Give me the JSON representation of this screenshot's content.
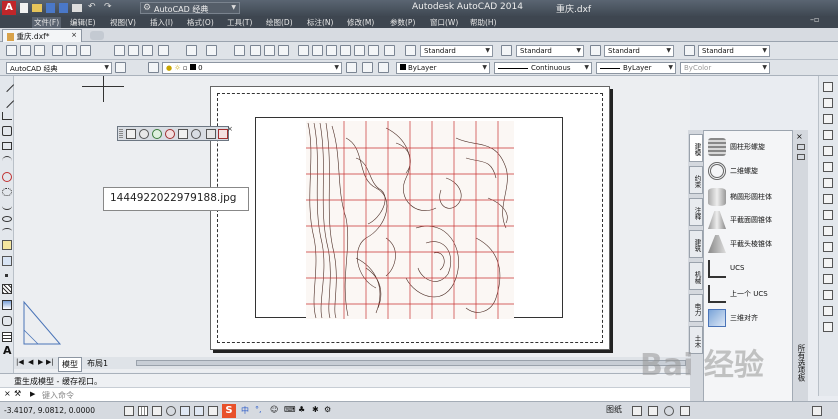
{
  "title_bar": {
    "workspace": "AutoCAD 经典",
    "app_title": "Autodesk AutoCAD 2014",
    "file_title": "重庆.dxf"
  },
  "menu": [
    "文件(F)",
    "编辑(E)",
    "视图(V)",
    "插入(I)",
    "格式(O)",
    "工具(T)",
    "绘图(D)",
    "标注(N)",
    "修改(M)",
    "参数(P)",
    "窗口(W)",
    "帮助(H)"
  ],
  "file_tab": "重庆.dxf*",
  "styles": {
    "text_style": "Standard",
    "dim_style": "Standard",
    "table_style": "Standard",
    "mleader_style": "Standard"
  },
  "layer_bar": {
    "workspace": "AutoCAD 经典",
    "layer": "0",
    "color": "ByLayer",
    "linetype": "Continuous",
    "lineweight": "ByLayer",
    "plotstyle": "ByColor"
  },
  "tooltip": "1444922022979188.jpg",
  "palette": {
    "title": "所有选项板",
    "tabs": [
      "建模",
      "约束",
      "注释",
      "建筑",
      "机械",
      "电力",
      "土木"
    ],
    "items": [
      {
        "label": "圆柱形螺旋",
        "icon": "helix-icon"
      },
      {
        "label": "二维螺旋",
        "icon": "spiral-icon"
      },
      {
        "label": "椭圆形圆柱体",
        "icon": "elliptical-cylinder-icon"
      },
      {
        "label": "平截面圆锥体",
        "icon": "frustum-cone-icon"
      },
      {
        "label": "平截头棱锥体",
        "icon": "frustum-pyramid-icon"
      },
      {
        "label": "UCS",
        "icon": "ucs-icon"
      },
      {
        "label": "上一个 UCS",
        "icon": "previous-ucs-icon"
      },
      {
        "label": "三维对齐",
        "icon": "3d-align-icon"
      }
    ]
  },
  "layout_tabs": [
    "模型",
    "布局1"
  ],
  "command_history": "重生成模型 - 缓存视口。",
  "command_prompt": "键入命令",
  "status": {
    "coords": "-3.4107, 9.0812, 0.0000",
    "paper_label": "图纸"
  },
  "watermark": "Bai 经验"
}
